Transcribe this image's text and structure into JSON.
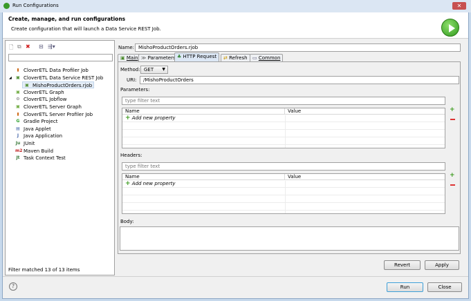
{
  "window": {
    "title": "Run Configurations",
    "close": "✕"
  },
  "header": {
    "title": "Create, manage, and run configurations",
    "subtitle": "Create configuration that will launch a Data Service REST Job."
  },
  "left": {
    "filter_placeholder": "",
    "items": [
      {
        "label": "CloverETL Data Profiler Job",
        "icon": "profiler-icon",
        "glyph": "▮",
        "color": "#d07020"
      },
      {
        "label": "CloverETL Data Service REST Job",
        "icon": "rest-job-icon",
        "glyph": "▣",
        "color": "#4a8a2a",
        "expanded": true
      },
      {
        "label": "MishoProductOrders.rjob",
        "icon": "rest-job-icon",
        "glyph": "▣",
        "color": "#4a8a2a",
        "child": true
      },
      {
        "label": "CloverETL Graph",
        "icon": "graph-icon",
        "glyph": "▣",
        "color": "#6aa83a"
      },
      {
        "label": "CloverETL Jobflow",
        "icon": "jobflow-icon",
        "glyph": "⚙",
        "color": "#777"
      },
      {
        "label": "CloverETL Server Graph",
        "icon": "graph-icon",
        "glyph": "▣",
        "color": "#6aa83a"
      },
      {
        "label": "CloverETL Server Profiler Job",
        "icon": "profiler-icon",
        "glyph": "▮",
        "color": "#d07020"
      },
      {
        "label": "Gradle Project",
        "icon": "gradle-icon",
        "glyph": "G",
        "color": "#2aa02a"
      },
      {
        "label": "Java Applet",
        "icon": "applet-icon",
        "glyph": "▤",
        "color": "#4466aa"
      },
      {
        "label": "Java Application",
        "icon": "java-app-icon",
        "glyph": "J",
        "color": "#4466aa"
      },
      {
        "label": "JUnit",
        "icon": "junit-icon",
        "glyph": "Ju",
        "color": "#3a7a3a"
      },
      {
        "label": "Maven Build",
        "icon": "maven-icon",
        "glyph": "m2",
        "color": "#c02020"
      },
      {
        "label": "Task Context Test",
        "icon": "task-test-icon",
        "glyph": "Jt",
        "color": "#3a7a3a"
      }
    ],
    "filter_status": "Filter matched 13 of 13 items"
  },
  "config": {
    "name_label": "Name:",
    "name_value": "MishoProductOrders.rjob",
    "tabs": [
      {
        "label": "Main"
      },
      {
        "label": "Parameters"
      },
      {
        "label": "HTTP Request",
        "selected": true
      },
      {
        "label": "Refresh"
      },
      {
        "label": "Common"
      }
    ],
    "method_label": "Method:",
    "method_value": "GET",
    "uri_label": "URI:",
    "uri_value": "/MishoProductOrders",
    "parameters": {
      "label": "Parameters:",
      "filter_placeholder": "type filter text",
      "columns": [
        "Name",
        "Value"
      ],
      "add_label": "Add new property"
    },
    "headers": {
      "label": "Headers:",
      "filter_placeholder": "type filter text",
      "columns": [
        "Name",
        "Value"
      ],
      "add_label": "Add new property"
    },
    "body_label": "Body:",
    "revert": "Revert",
    "apply": "Apply"
  },
  "footer": {
    "help": "?",
    "run": "Run",
    "close": "Close"
  }
}
